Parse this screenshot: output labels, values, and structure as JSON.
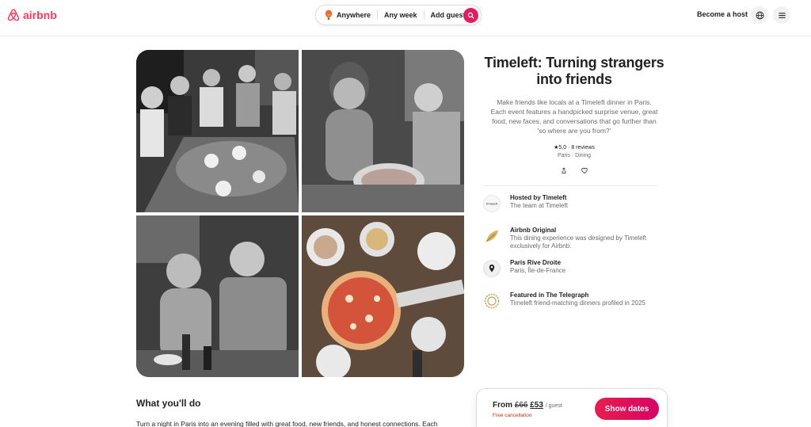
{
  "header": {
    "logo_text": "airbnb",
    "search": {
      "location": "Anywhere",
      "dates": "Any week",
      "guests": "Add guests"
    },
    "become_host": "Become a host"
  },
  "gallery": {
    "photos": [
      "dinner-table-group",
      "woman-laughing",
      "couple-laughing",
      "pizza-table"
    ]
  },
  "experience": {
    "title": "Timeleft: Turning strangers into friends",
    "description": "Make friends like locals at a Timeleft dinner in Paris. Each event features a handpicked surprise venue, great food, new faces, and conversations that go further than 'so where are you from?'",
    "rating": "★5,0 · 8 reviews",
    "meta": "Paris · Dining"
  },
  "info": [
    {
      "title": "Hosted by Timeleft",
      "sub": "The team at Timeleft",
      "icon": "timeleft-avatar-icon"
    },
    {
      "title": "Airbnb Original",
      "sub": "This dining experience was designed by Timeleft exclusively for Airbnb.",
      "icon": "leaf-icon"
    },
    {
      "title": "Paris Rive Droite",
      "sub": "Paris, Île-de-France",
      "icon": "map-pin-icon"
    },
    {
      "title": "Featured in The Telegraph",
      "sub": "Timeleft friend-matching dinners profiled in 2025",
      "icon": "seal-icon"
    }
  ],
  "what_you_do": {
    "heading": "What you'll do",
    "text": "Turn a night in Paris into an evening filled with great food, new friends, and honest connections. Each"
  },
  "booking": {
    "from": "From",
    "old_price": "£66",
    "new_price": "£53",
    "per": "/ guest",
    "cancellation": "Free cancellation",
    "cta": "Show dates"
  },
  "colors": {
    "brand": "#ff385c",
    "cta": "#e61e4d",
    "cancel": "#c13515"
  }
}
